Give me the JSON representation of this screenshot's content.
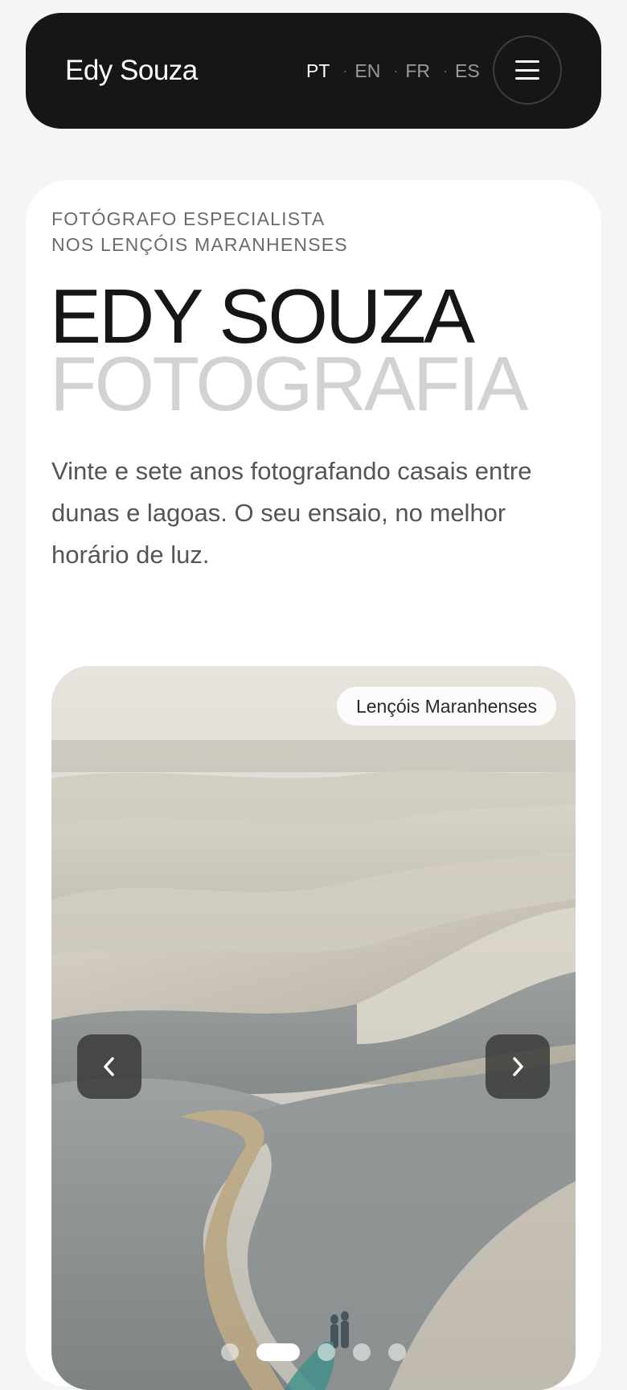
{
  "header": {
    "brand": "Edy Souza",
    "languages": [
      {
        "code": "PT",
        "active": true
      },
      {
        "code": "EN",
        "active": false
      },
      {
        "code": "FR",
        "active": false
      },
      {
        "code": "ES",
        "active": false
      }
    ],
    "separator": "·",
    "menu_icon": "hamburger-menu-icon"
  },
  "hero": {
    "eyebrow_line1": "FOTÓGRAFO ESPECIALISTA",
    "eyebrow_line2": "NOS LENÇÓIS MARANHENSES",
    "title_line1": "EDY SOUZA",
    "title_line2": "FOTOGRAFIA",
    "lead": "Vinte e sete anos fotografando casais entre dunas e lagoas. O seu ensaio, no melhor horário de luz."
  },
  "carousel": {
    "location_badge": "Lençóis Maranhenses",
    "prev_icon": "chevron-left-icon",
    "next_icon": "chevron-right-icon",
    "slide_count": 5,
    "active_slide": 2
  },
  "colors": {
    "header_bg": "#161616",
    "page_bg": "#f5f5f5",
    "title_primary": "#161616",
    "title_secondary": "#d2d2d2"
  }
}
